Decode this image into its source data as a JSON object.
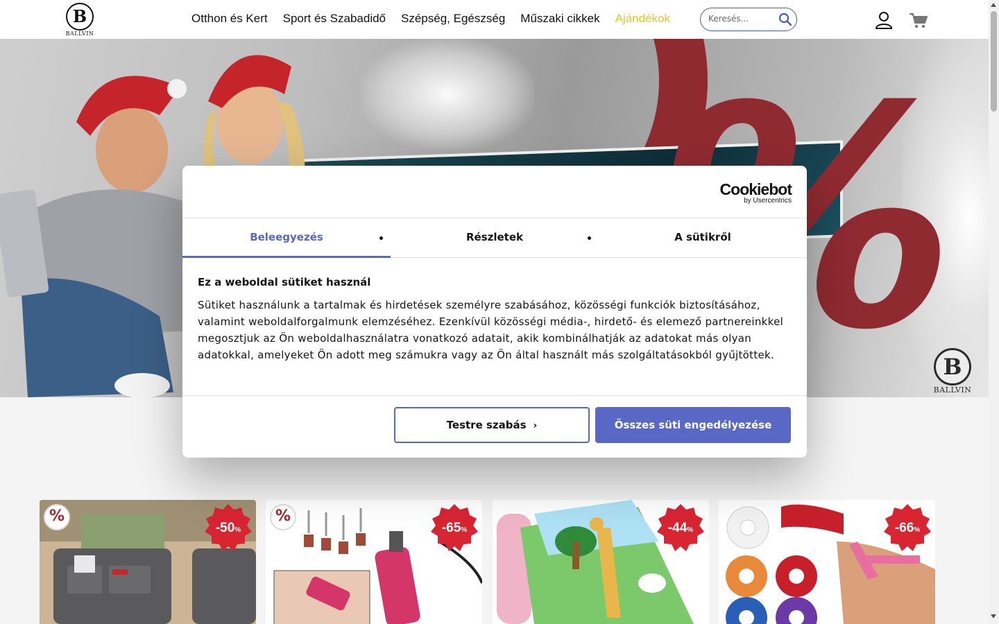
{
  "header": {
    "logo_text": "BALLVIN",
    "logo_letter": "B",
    "nav": [
      {
        "label": "Otthon és Kert"
      },
      {
        "label": "Sport és Szabadidő"
      },
      {
        "label": "Szépség, Egészség"
      },
      {
        "label": "Műszaki cikkek"
      },
      {
        "label": "Ajándékok"
      }
    ],
    "search_placeholder": "Keresés...",
    "highlight_color": "#f0c419"
  },
  "hero": {
    "percent_symbol": "%",
    "logo_letter": "B",
    "logo_text": "BALLVIN",
    "accent_color": "#8f2a31"
  },
  "products": [
    {
      "discount": "-50",
      "unit": "%",
      "seal": "%"
    },
    {
      "discount": "-65",
      "unit": "%",
      "seal": "%"
    },
    {
      "discount": "-44",
      "unit": "%"
    },
    {
      "discount": "-66",
      "unit": "%"
    }
  ],
  "cookie_dialog": {
    "brand": "Cookiebot",
    "brand_sub": "by Usercentrics",
    "tabs": [
      {
        "label": "Beleegyezés",
        "active": true
      },
      {
        "label": "Részletek"
      },
      {
        "label": "A sütikről"
      }
    ],
    "heading": "Ez a weboldal sütiket használ",
    "body": "Sütiket használunk a tartalmak és hirdetések személyre szabásához, közösségi funkciók biztosításához, valamint weboldalforgalmunk elemzéséhez. Ezenkívül közösségi média-, hirdető- és elemező partnereinkkel megosztjuk az Ön weboldalhasználatra vonatkozó adatait, akik kombinálhatják az adatokat más olyan adatokkal, amelyeket Ön adott meg számukra vagy az Ön által használt más szolgáltatásokból gyűjtöttek.",
    "customize_label": "Testre szabás",
    "allow_all_label": "Összes süti engedélyezése",
    "accent_color": "#5968c4"
  }
}
